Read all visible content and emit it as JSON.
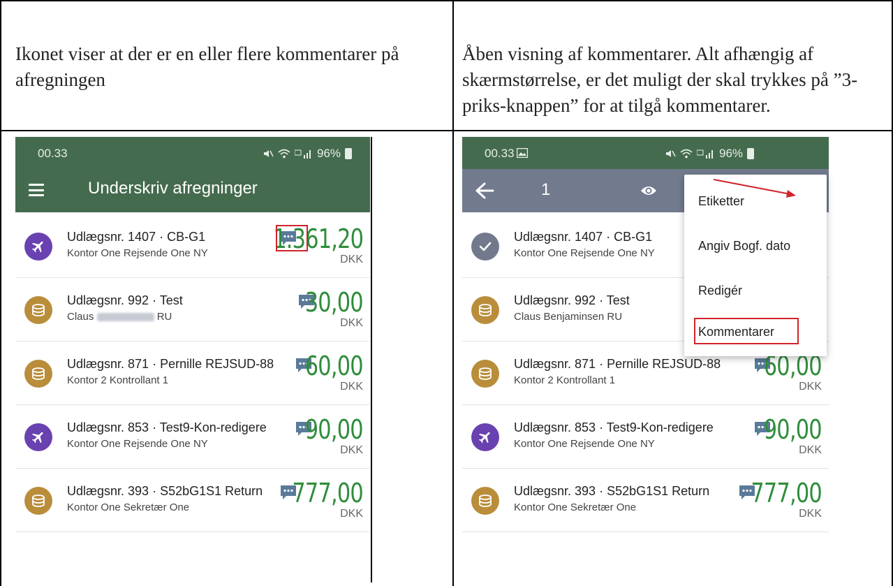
{
  "captions": {
    "left": "Ikonet viser at der er en eller flere kommentarer på afregningen",
    "right": "Åben visning af kommentarer. Alt afhængig af skærmstørrelse, er det muligt der skal trykkes på ”3-priks-knappen” for at tilgå kommentarer."
  },
  "colors": {
    "header_green": "#456b4e",
    "toolbar_grey": "#727b8d",
    "amount_green": "#2f8d3b",
    "highlight_red": "#d2232a",
    "avatar_purple": "#6a41b0",
    "avatar_gold": "#b98d3a"
  },
  "left_screen": {
    "status": {
      "time": "00.33",
      "right_text": "96%",
      "icons": [
        "mute-icon",
        "wifi-icon",
        "volte-icon",
        "signal-icon",
        "battery-icon"
      ]
    },
    "appbar": {
      "title": "Underskriv afregninger",
      "menu_icon": "hamburger-menu-icon"
    },
    "rows": [
      {
        "title": "Udlægsnr. 1407 · CB-G1",
        "subtitle": "Kontor One Rejsende One NY",
        "amount": "1.361,20",
        "currency": "DKK",
        "avatar": "plane-icon"
      },
      {
        "title": "Udlægsnr. 992 · Test",
        "subtitle_prefix": "Claus",
        "subtitle_suffix": "RU",
        "amount": "30,00",
        "currency": "DKK",
        "avatar": "coins-icon"
      },
      {
        "title": "Udlægsnr. 871 · Pernille REJSUD-88",
        "subtitle": "Kontor 2 Kontrollant 1",
        "amount": "60,00",
        "currency": "DKK",
        "avatar": "coins-icon"
      },
      {
        "title": "Udlægsnr. 853 · Test9-Kon-redigere",
        "subtitle": "Kontor One Rejsende One NY",
        "amount": "90,00",
        "currency": "DKK",
        "avatar": "plane-icon"
      },
      {
        "title": "Udlægsnr. 393 · S52bG1S1 Return",
        "subtitle": "Kontor One Sekretær One",
        "amount": "777,00",
        "currency": "DKK",
        "avatar": "coins-icon"
      }
    ]
  },
  "right_screen": {
    "status": {
      "time": "00.33",
      "right_text": "96%",
      "icons": [
        "image-icon",
        "mute-icon",
        "wifi-icon",
        "volte-icon",
        "signal-icon",
        "battery-icon"
      ]
    },
    "appbar": {
      "count": "1",
      "back_icon": "arrow-left-icon",
      "view_icon": "eye-icon"
    },
    "menu": {
      "items": [
        "Etiketter",
        "Angiv Bogf. dato",
        "Redigér",
        "Kommentarer"
      ]
    },
    "rows": [
      {
        "title": "Udlægsnr. 1407 · CB-G1",
        "subtitle": "Kontor One Rejsende One NY",
        "avatar": "check-icon"
      },
      {
        "title": "Udlægsnr. 992 · Test",
        "subtitle": "Claus Benjaminsen RU",
        "avatar": "coins-icon"
      },
      {
        "title": "Udlægsnr. 871 · Pernille REJSUD-88",
        "subtitle": "Kontor 2 Kontrollant 1",
        "amount": "60,00",
        "currency": "DKK",
        "avatar": "coins-icon"
      },
      {
        "title": "Udlægsnr. 853 · Test9-Kon-redigere",
        "subtitle": "Kontor One Rejsende One NY",
        "amount": "90,00",
        "currency": "DKK",
        "avatar": "plane-icon"
      },
      {
        "title": "Udlægsnr. 393 · S52bG1S1 Return",
        "subtitle": "Kontor One Sekretær One",
        "amount": "777,00",
        "currency": "DKK",
        "avatar": "coins-icon"
      }
    ]
  }
}
